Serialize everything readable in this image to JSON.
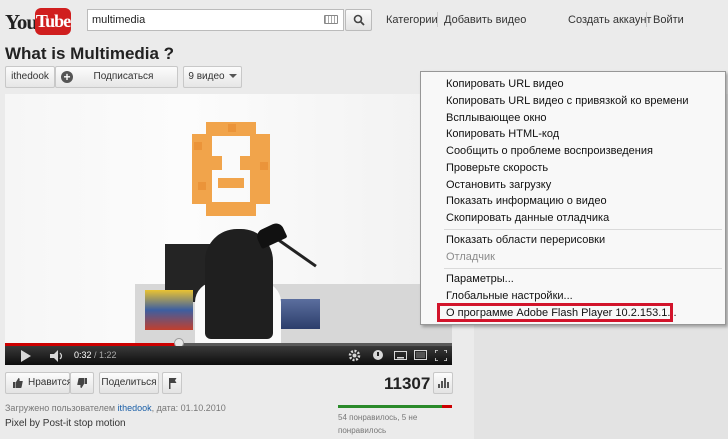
{
  "header": {
    "logo": {
      "you": "You",
      "tube": "Tube"
    },
    "search_value": "multimedia",
    "links": [
      "Категории",
      "Добавить видео",
      "Создать аккаунт",
      "Войти"
    ]
  },
  "video": {
    "title": "What is Multimedia ?",
    "channel": "ithedook",
    "subscribe_label": "Подписаться",
    "videos_label": "9 видео",
    "time_current": "0:32",
    "time_duration": "/ 1:22",
    "progress": 0.39
  },
  "context_menu": {
    "group1": [
      "Копировать URL видео",
      "Копировать URL видео с привязкой ко времени",
      "Всплывающее окно",
      "Копировать HTML-код",
      "Сообщить о проблеме воспроизведения",
      "Проверьте скорость",
      "Остановить загрузку",
      "Показать информацию о видео",
      "Скопировать данные отладчика"
    ],
    "group2": [
      "Показать области перерисовки",
      "Отладчик"
    ],
    "group3": [
      "Параметры...",
      "Глобальные настройки...",
      "О программе Adobe Flash Player 10.2.153.1..."
    ]
  },
  "actions": {
    "like_label": "Нравится",
    "share_label": "Поделиться",
    "views": "11307"
  },
  "meta": {
    "uploaded_prefix": "Загружено пользователем",
    "uploader": "ithedook",
    "uploaded_date": ", дата: 01.10.2010",
    "description": "Pixel by Post-it stop motion",
    "likes_text": "54 понравилось, 5 не понравилось",
    "like_ratio": 0.915
  },
  "colors": {
    "accent": "#d2142b",
    "brand_red": "#d01e1e",
    "like_green": "#2a8a2a"
  }
}
